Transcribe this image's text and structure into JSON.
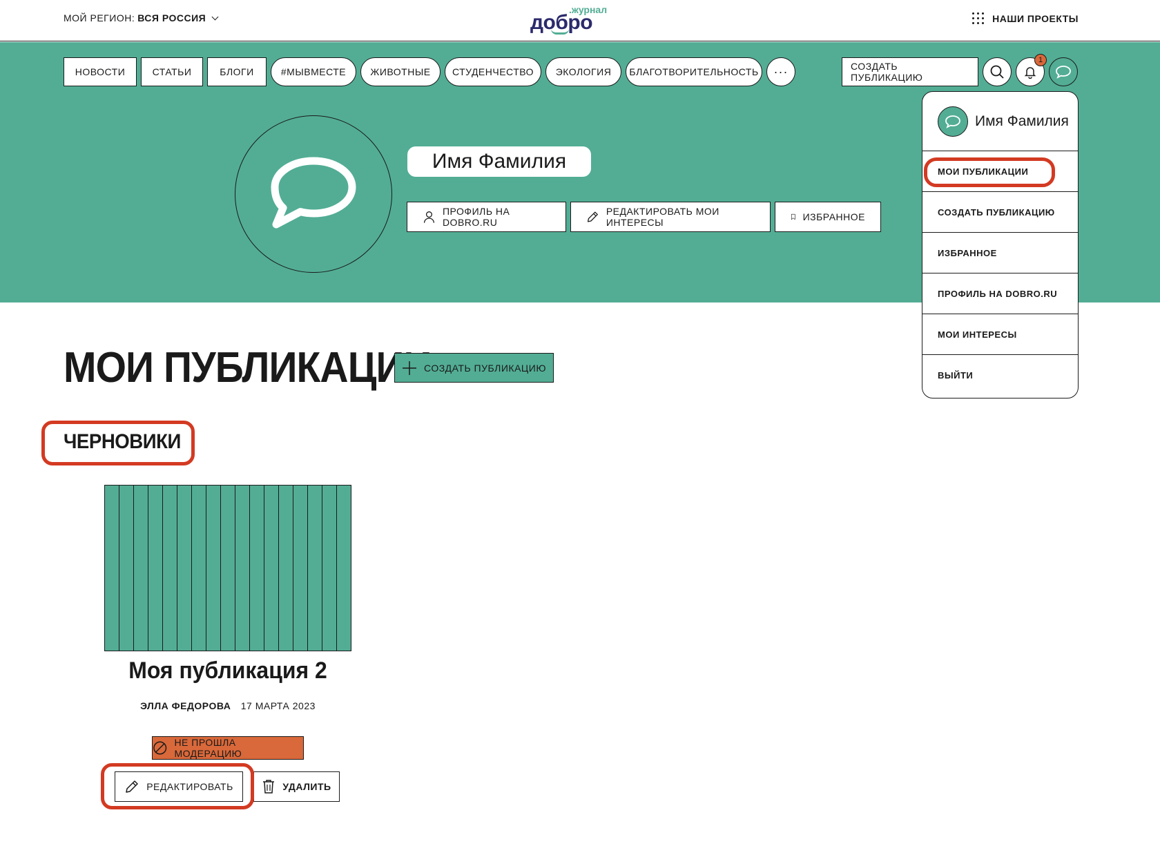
{
  "header": {
    "region_label": "МОЙ РЕГИОН:",
    "region_value": "ВСЯ РОССИЯ",
    "logo_main": "добро",
    "logo_sub": ".журнал",
    "projects_label": "НАШИ ПРОЕКТЫ"
  },
  "nav": {
    "items": [
      "НОВОСТИ",
      "СТАТЬИ",
      "БЛОГИ",
      "#МЫВМЕСТЕ",
      "ЖИВОТНЫЕ",
      "СТУДЕНЧЕСТВО",
      "ЭКОЛОГИЯ",
      "БЛАГОТВОРИТЕЛЬНОСТЬ"
    ],
    "more_label": "···",
    "create_label": "СОЗДАТЬ ПУБЛИКАЦИЮ",
    "notification_count": "1"
  },
  "profile": {
    "name": "Имя Фамилия",
    "profile_link": "ПРОФИЛЬ НА DOBRO.RU",
    "edit_interests": "РЕДАКТИРОВАТЬ МОИ ИНТЕРЕСЫ",
    "favorites": "ИЗБРАННОЕ"
  },
  "dropdown": {
    "name": "Имя Фамилия",
    "items": [
      "МОИ ПУБЛИКАЦИИ",
      "СОЗДАТЬ ПУБЛИКАЦИЮ",
      "ИЗБРАННОЕ",
      "ПРОФИЛЬ НА DOBRO.RU",
      "МОИ ИНТЕРЕСЫ",
      "ВЫЙТИ"
    ]
  },
  "main": {
    "title": "МОИ ПУБЛИКАЦИИ",
    "create_button": "СОЗДАТЬ ПУБЛИКАЦИЮ",
    "section": "ЧЕРНОВИКИ"
  },
  "card": {
    "title": "Моя публикация 2",
    "author": "ЭЛЛА ФЕДОРОВА",
    "date": "17 МАРТА 2023",
    "status": "НЕ ПРОШЛА МОДЕРАЦИЮ",
    "edit_label": "РЕДАКТИРОВАТЬ",
    "delete_label": "УДАЛИТЬ"
  },
  "colors": {
    "brand_green": "#52ad94",
    "brand_navy": "#2b2a6b",
    "status_orange": "#d9683a",
    "highlight_red": "#d33a22"
  }
}
